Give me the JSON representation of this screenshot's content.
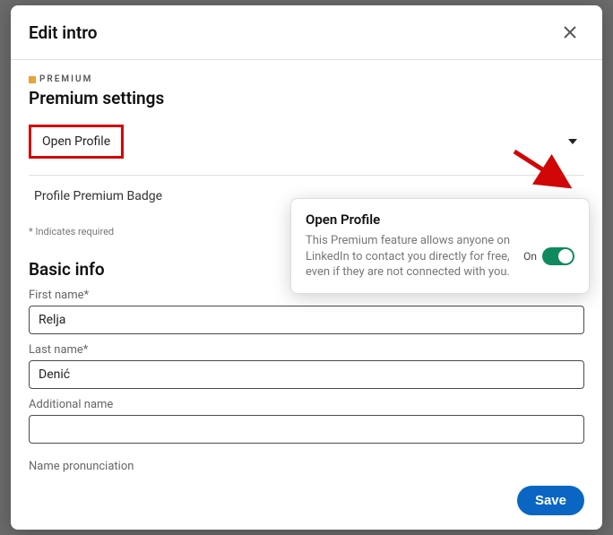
{
  "header": {
    "title": "Edit intro"
  },
  "premium": {
    "badge": "PREMIUM",
    "heading": "Premium settings",
    "open_profile_label": "Open Profile",
    "profile_badge_label": "Profile Premium Badge"
  },
  "required_note": "* Indicates required",
  "basic_info": {
    "heading": "Basic info",
    "first_name_label": "First name*",
    "first_name_value": "Relja",
    "last_name_label": "Last name*",
    "last_name_value": "Denić",
    "additional_name_label": "Additional name",
    "additional_name_value": "",
    "name_pronunciation_label": "Name pronunciation"
  },
  "popover": {
    "title": "Open Profile",
    "desc": "This Premium feature allows anyone on LinkedIn to contact you directly for free, even if they are not connected with you.",
    "state_label": "On"
  },
  "footer": {
    "save_label": "Save"
  }
}
